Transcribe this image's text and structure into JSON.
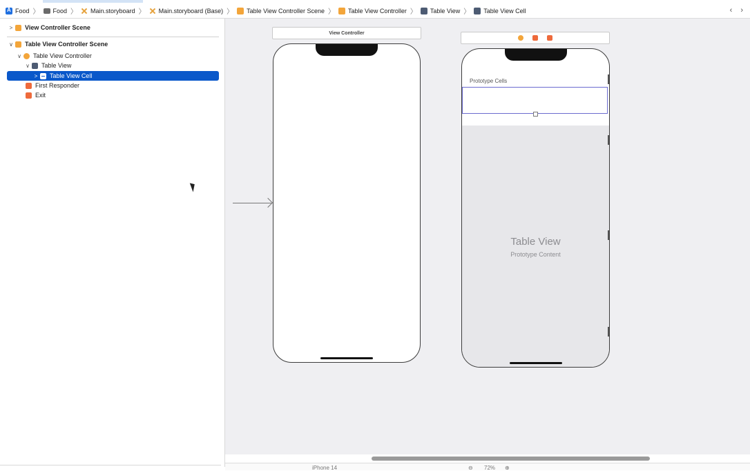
{
  "breadcrumbs": [
    {
      "label": "Food",
      "icon": "app-icon"
    },
    {
      "label": "Food",
      "icon": "folder-icon"
    },
    {
      "label": "Main.storyboard",
      "icon": "storyboard-icon"
    },
    {
      "label": "Main.storyboard (Base)",
      "icon": "storyboard-icon"
    },
    {
      "label": "Table View Controller Scene",
      "icon": "scene-icon"
    },
    {
      "label": "Table View Controller",
      "icon": "view-controller-icon"
    },
    {
      "label": "Table View",
      "icon": "table-view-icon"
    },
    {
      "label": "Table View Cell",
      "icon": "table-cell-icon"
    }
  ],
  "nav": {
    "back": "‹",
    "forward": "›"
  },
  "outline": {
    "vc_scene": "View Controller Scene",
    "tvc_scene": "Table View Controller Scene",
    "tvc": "Table View Controller",
    "table_view": "Table View",
    "table_cell": "Table View Cell",
    "first_responder": "First Responder",
    "exit": "Exit"
  },
  "canvas": {
    "vc_title": "View Controller",
    "prototype_cells": "Prototype Cells",
    "table_view_title": "Table View",
    "table_view_sub": "Prototype Content"
  },
  "bottombar": {
    "device": "iPhone 14",
    "zoom": "72%",
    "zoom_out": "⊖",
    "zoom_in": "⊕"
  },
  "colors": {
    "selection": "#0a58ca",
    "canvas": "#efeff2",
    "scene_icon": "#f3a53a",
    "responder_icon": "#ee6a3b"
  }
}
